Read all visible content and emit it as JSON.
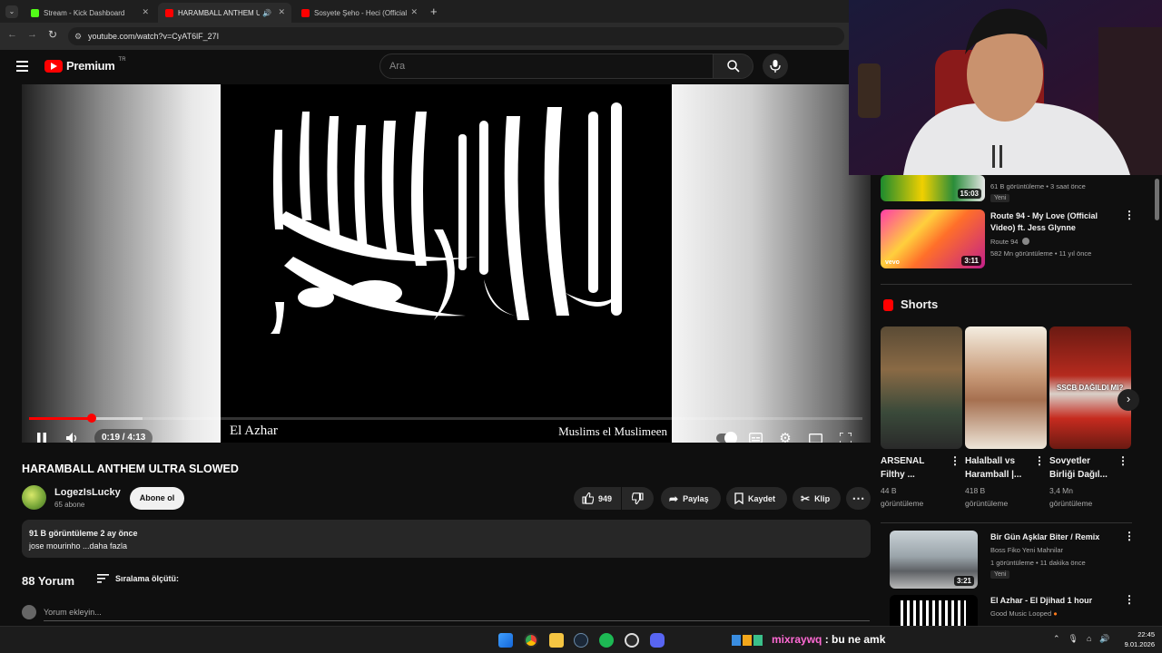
{
  "browser": {
    "tabs": [
      {
        "title": "Stream - Kick Dashboard",
        "active": false,
        "favicon_color": "#53fc18"
      },
      {
        "title": "HARAMBALL ANTHEM ULTRA SLOWED",
        "active": true,
        "favicon_color": "#ff0000"
      },
      {
        "title": "Sosyete Şeho - Heci (Official Music Video)",
        "active": false,
        "favicon_color": "#ff0000"
      }
    ],
    "url": "youtube.com/watch?v=CyAT6lF_27I"
  },
  "header": {
    "logo_text": "Premium",
    "logo_region": "TR",
    "search_placeholder": "Ara"
  },
  "player": {
    "caption_left": "El Azhar",
    "caption_right": "Muslims el Muslimeen",
    "time": "0:19 / 4:13",
    "progress": 0.075,
    "accent": "#ff0000"
  },
  "video": {
    "title": "HARAMBALL ANTHEM ULTRA SLOWED",
    "channel": "LogezIsLucky",
    "subscribers": "65 abone",
    "subscribe_label": "Abone ol",
    "likes": "949",
    "share_label": "Paylaş",
    "save_label": "Kaydet",
    "clip_label": "Klip",
    "views_date": "91 B görüntüleme  2 ay önce",
    "description": "jose mourinho ...daha fazla"
  },
  "comments": {
    "count_label": "88 Yorum",
    "sort_label": "Sıralama ölçütü:",
    "add_placeholder": "Yorum ekleyin..."
  },
  "sidebar": {
    "top_partial": {
      "meta": "61 B görüntüleme • 3 saat önce",
      "badge": "Yeni",
      "duration": "15:03"
    },
    "items_top": [
      {
        "title_line1": "Route 94 - My Love (Official",
        "title_line2": "Video) ft. Jess Glynne",
        "channel": "Route 94",
        "meta": "582 Mn görüntüleme • 11 yıl önce",
        "duration": "3:11"
      }
    ],
    "shorts_header": "Shorts",
    "shorts": [
      {
        "title_line1": "ARSENAL",
        "title_line2": "Filthy ...",
        "views_line1": "44 B",
        "views_line2": "görüntüleme"
      },
      {
        "title_line1": "Halalball vs",
        "title_line2": "Haramball |...",
        "views_line1": "418 B",
        "views_line2": "görüntüleme"
      },
      {
        "title_line1": "Sovyetler",
        "title_line2": "Birliği Dağıl...",
        "views_line1": "3,4 Mn",
        "views_line2": "görüntüleme"
      }
    ],
    "short3_overlay": "SSCB DAĞILDI MI?",
    "items_bottom": [
      {
        "title": "Bir Gün Aşklar Biter / Remix",
        "channel": "Boss Fiko Yeni Mahnilar",
        "meta": "1 görüntüleme • 11 dakika önce",
        "badge": "Yeni",
        "duration": "3:21"
      },
      {
        "title": "El Azhar - El Djihad 1 hour",
        "channel": "Good Music Looped"
      }
    ]
  },
  "taskbar": {
    "chat_user": "mixraywq",
    "chat_sep": ":",
    "chat_message": "bu ne amk",
    "time": "22:45",
    "date": "9.01.2026"
  }
}
